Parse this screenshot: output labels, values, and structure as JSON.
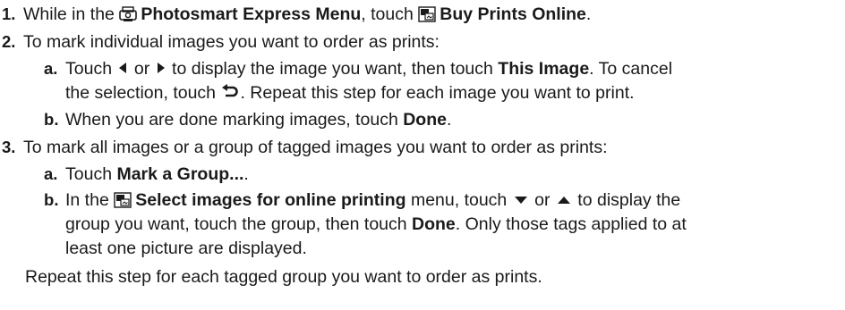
{
  "steps": [
    {
      "number": "1.",
      "parts": {
        "a": "While in the ",
        "b": "Photosmart Express Menu",
        "c": ", touch ",
        "d": "Buy Prints Online",
        "e": "."
      },
      "icons": [
        "photosmart-express-icon",
        "buy-prints-icon"
      ]
    },
    {
      "number": "2.",
      "text": "To mark individual images you want to order as prints:",
      "substeps": [
        {
          "letter": "a",
          "line1": {
            "a": "Touch ",
            "b": " or ",
            "c": " to display the image you want, then touch ",
            "d": "This Image",
            "e": ". To cancel"
          },
          "line2": {
            "a": "the selection, touch ",
            "b": ". Repeat this step for each image you want to print."
          },
          "icons": [
            "left-arrow-icon",
            "right-arrow-icon",
            "undo-icon"
          ]
        },
        {
          "letter": "b",
          "parts": {
            "a": "When you are done marking images, touch ",
            "b": "Done",
            "c": "."
          }
        }
      ]
    },
    {
      "number": "3.",
      "text": "To mark all images or a group of tagged images you want to order as prints:",
      "substeps": [
        {
          "letter": "a",
          "parts": {
            "a": "Touch ",
            "b": "Mark a Group...",
            "c": "."
          }
        },
        {
          "letter": "b",
          "line1": {
            "a": "In the ",
            "b": "Select images for online printing",
            "c": " menu, touch ",
            "d": " or ",
            "e": " to display the"
          },
          "line2": {
            "a": "group you want, touch the group, then touch ",
            "b": "Done",
            "c": ". Only those tags applied to at"
          },
          "line3": "least one picture are displayed.",
          "icons": [
            "select-images-icon",
            "down-arrow-icon",
            "up-arrow-icon"
          ]
        }
      ],
      "footer": "Repeat this step for each tagged group you want to order as prints."
    }
  ],
  "colors": {
    "text": "#1a1a1a",
    "background": "#ffffff"
  }
}
